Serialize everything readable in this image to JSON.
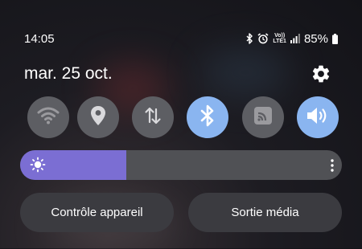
{
  "status_bar": {
    "time": "14:05",
    "volte_top": "Vo))",
    "volte_bottom": "LTE1",
    "battery": "85%",
    "icons": [
      "bluetooth-icon",
      "alarm-icon",
      "volte-icon",
      "signal-icon",
      "battery-icon"
    ]
  },
  "header": {
    "date": "mar. 25 oct.",
    "settings_icon": "gear-icon"
  },
  "quick_tiles": [
    {
      "name": "wifi",
      "icon": "wifi-icon",
      "active": false
    },
    {
      "name": "location",
      "icon": "location-pin-icon",
      "active": false
    },
    {
      "name": "mobile-data",
      "icon": "data-arrows-icon",
      "active": false
    },
    {
      "name": "bluetooth",
      "icon": "bluetooth-icon",
      "active": true
    },
    {
      "name": "cast",
      "icon": "cast-icon",
      "active": false
    },
    {
      "name": "sound",
      "icon": "volume-icon",
      "active": true
    }
  ],
  "brightness": {
    "level": 0.33,
    "icon": "sun-icon",
    "more_icon": "more-vertical-icon"
  },
  "buttons": {
    "device_control": "Contrôle appareil",
    "media_output": "Sortie média"
  },
  "colors": {
    "tile_off": "#5d5e63",
    "tile_on": "#8ab5f0",
    "brightness_fill": "#7b6ed3",
    "slider_track": "#505155",
    "button_bg": "#3b3b40"
  }
}
